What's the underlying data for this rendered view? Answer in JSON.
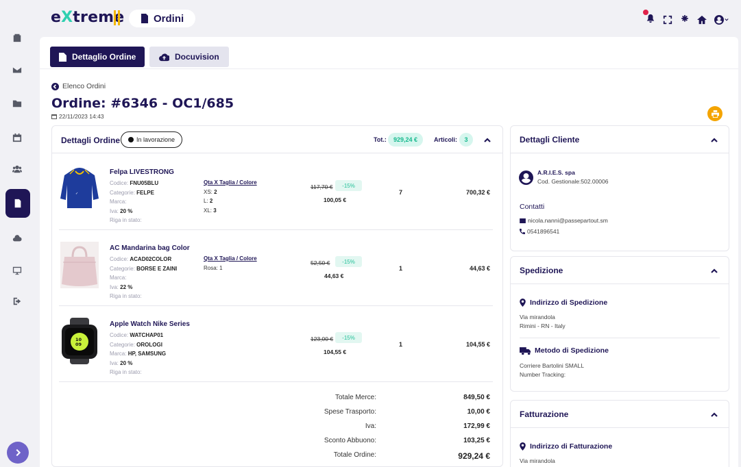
{
  "app": {
    "logo_prefix": "e",
    "logo_x": "X",
    "logo_suffix": "treme",
    "page_title": "Ordini"
  },
  "sidebar": {
    "items": [
      "orders-icon",
      "mail-icon",
      "folder-icon",
      "calendar-icon",
      "users-icon",
      "document-icon",
      "cloud-icon",
      "monitor-icon",
      "logout-icon"
    ],
    "active": "document-icon"
  },
  "tabs": {
    "detail": "Dettaglio Ordine",
    "docuvision": "Docuvision"
  },
  "nav": {
    "back": "Elenco Ordini"
  },
  "order": {
    "title": "Ordine: #6346 - OC1/685",
    "date": "22/11/2023 14:43"
  },
  "order_card": {
    "title": "Dettagli Ordine",
    "status": "In lavorazione",
    "tot_label": "Tot.:",
    "tot_value": "929,24 €",
    "articles_label": "Articoli:",
    "articles_value": "3"
  },
  "labels": {
    "code": "Codice:",
    "category": "Categorie:",
    "brand": "Marca:",
    "vat": "Iva:",
    "row_state": "Riga in stato:",
    "qta_link": "Qta X Taglia / Colore"
  },
  "products": [
    {
      "name": "Felpa LIVESTRONG",
      "code": "FNU05BLU",
      "category": "FELPE",
      "brand": "",
      "vat": "20 %",
      "sizes": [
        [
          "XS:",
          "2"
        ],
        [
          "L:",
          "2"
        ],
        [
          "XL:",
          "3"
        ]
      ],
      "old_price": "117,70 €",
      "discount": "-15%",
      "new_price": "100,05 €",
      "qty": "7",
      "total": "700,32 €"
    },
    {
      "name": "AC Mandarina bag Color",
      "code": "ACAD02COLOR",
      "category": "BORSE E ZAINI",
      "brand": "",
      "vat": "22 %",
      "sizes": [
        [
          "Rosa:",
          "1"
        ]
      ],
      "old_price": "52,50 €",
      "discount": "-15%",
      "new_price": "44,63 €",
      "qty": "1",
      "total": "44,63 €"
    },
    {
      "name": "Apple Watch Nike Series",
      "code": "WATCHAP01",
      "category": "OROLOGI",
      "brand": "HP, SAMSUNG",
      "vat": "20 %",
      "sizes": [],
      "old_price": "123,00 €",
      "discount": "-15%",
      "new_price": "104,55 €",
      "qty": "1",
      "total": "104,55 €"
    }
  ],
  "totals": [
    {
      "label": "Totale Merce:",
      "value": "849,50 €"
    },
    {
      "label": "Spese Trasporto:",
      "value": "10,00 €"
    },
    {
      "label": "Iva:",
      "value": "172,99 €"
    },
    {
      "label": "Sconto Abbuono:",
      "value": "103,25 €"
    },
    {
      "label": "Totale Ordine:",
      "value": "929,24 €"
    }
  ],
  "customer": {
    "title": "Dettagli Cliente",
    "name": "A.R.I.E.S. spa",
    "code": "Cod. Gestionale:502.00006",
    "contacts_title": "Contatti",
    "email": "nicola.nanni@passepartout.sm",
    "phone": "0541896541"
  },
  "shipping": {
    "title": "Spedizione",
    "address_title": "Indirizzo di Spedizione",
    "address_line1": "Via mirandola",
    "address_line2": "Rimini - RN - Italy",
    "method_title": "Metodo di Spedizione",
    "method_line1": "Corriere Bartolini SMALL",
    "method_line2": "Number Tracking:"
  },
  "billing": {
    "title": "Fatturazione",
    "address_title": "Indirizzo di Fatturazione",
    "address_line1": "Via mirandola"
  },
  "colors": {
    "primary": "#1f1656",
    "accent": "#2fd0b0",
    "logo_bar": "#f3b700",
    "print": "#f4a400",
    "badge_bg": "#d6f6ee",
    "badge_text": "#17b98e",
    "toggle": "#6f63c8"
  }
}
